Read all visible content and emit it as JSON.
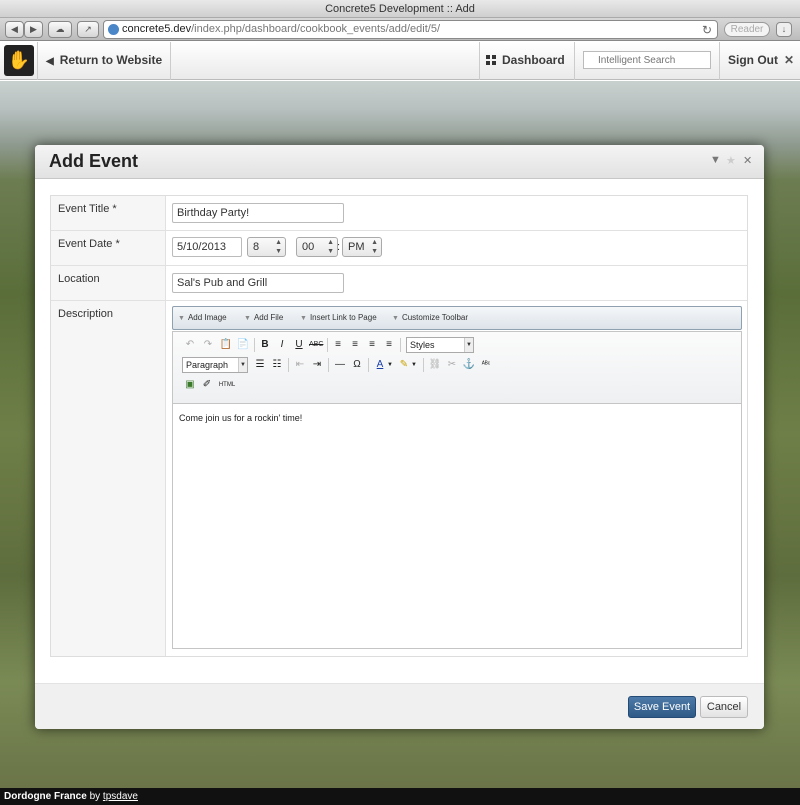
{
  "browser": {
    "window_title": "Concrete5 Development :: Add",
    "url_host": "concrete5.dev",
    "url_path": "/index.php/dashboard/cookbook_events/add/edit/5/",
    "reader_label": "Reader",
    "back_icon": "left-arrow-icon",
    "forward_icon": "right-arrow-icon"
  },
  "c5bar": {
    "return_label": "Return to Website",
    "dashboard_label": "Dashboard",
    "search_placeholder": "Intelligent Search",
    "signout_label": "Sign Out"
  },
  "dialog": {
    "title": "Add Event",
    "fields": {
      "title_label": "Event Title *",
      "title_value": "Birthday Party!",
      "date_label": "Event Date *",
      "date_value": "5/10/2013",
      "hour_value": "8",
      "minute_value": "00",
      "ampm_value": "PM",
      "location_label": "Location",
      "location_value": "Sal's Pub and Grill",
      "description_label": "Description"
    },
    "editor_tools": {
      "add_image": "Add Image",
      "add_file": "Add File",
      "insert_link": "Insert Link to Page",
      "customize": "Customize Toolbar"
    },
    "editor": {
      "styles_select": "Styles",
      "format_select": "Paragraph",
      "html_label": "HTML",
      "content": "Come join us for a rockin' time!"
    },
    "save_label": "Save Event",
    "cancel_label": "Cancel"
  },
  "footer": {
    "caption": "Dordogne France",
    "by": " by ",
    "author": "tpsdave"
  },
  "colors": {
    "primary_button": "#34608d",
    "footer_bg": "#111111"
  }
}
